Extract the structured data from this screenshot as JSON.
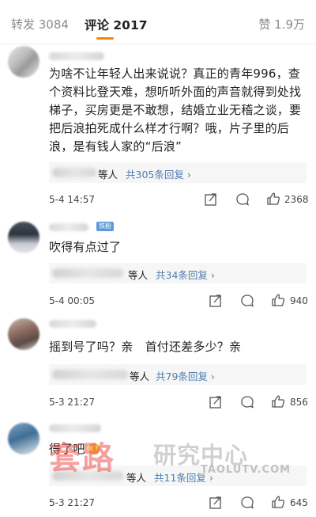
{
  "tabs": {
    "repost": "转发 3084",
    "comment": "评论 2017",
    "like": "赞 1.9万"
  },
  "comments": [
    {
      "text": "为啥不让年轻人出来说说？真正的青年996，查个资料比登天难，想听听外面的声音就得到处找梯子，买房更是不敢想，结婚立业无稽之谈，要把后浪拍死成什么样才行啊？哦，片子里的后浪，是有钱人家的“后浪”",
      "reply_suffix": "等人",
      "reply_link": "共305条回复 ›",
      "time": "5-4 14:57",
      "likes": "2368"
    },
    {
      "badge": "铁粉",
      "text": "吹得有点过了",
      "reply_suffix": "等人",
      "reply_link": "共34条回复 ›",
      "time": "5-4 00:05",
      "likes": "940"
    },
    {
      "text": "摇到号了吗？亲　首付还差多少？亲",
      "reply_suffix": "等人",
      "reply_link": "共79条回复 ›",
      "time": "5-3 21:27",
      "likes": "856"
    },
    {
      "text": "得了吧",
      "reply_suffix": "等人",
      "reply_link": "共11条回复 ›",
      "time": "5-3 21:27",
      "likes": "645"
    }
  ],
  "watermark": {
    "brand": "套路",
    "sub": "研究中心",
    "url": "TAOLUTV.COM"
  },
  "colors": {
    "accent": "#ff8200",
    "link": "#507daf",
    "reply_bg": "#f6f6f6"
  }
}
